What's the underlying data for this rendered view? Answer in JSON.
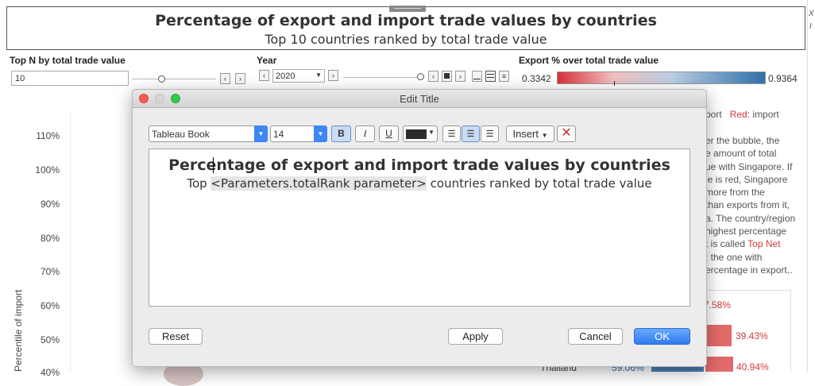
{
  "dashboard": {
    "title": "Percentage of export and import trade values by countries",
    "subtitle": "Top  10 countries ranked by total trade value"
  },
  "filters": {
    "topn_label": "Top N by total trade value",
    "topn_value": "10",
    "year_label": "Year",
    "year_value": "2020",
    "export_label": "Export % over total trade value",
    "export_min": "0.3342",
    "export_max": "0.9364",
    "gradient_colors": [
      "#d7323a",
      "#f2bfbf",
      "#b9cfe2",
      "#2e6fa8"
    ]
  },
  "chart": {
    "y_ticks": [
      "110%",
      "100%",
      "90%",
      "80%",
      "70%",
      "60%",
      "50%",
      "40%"
    ],
    "y_axis_label": "Percentile of import"
  },
  "legend": {
    "line1_tail": "port",
    "line1_red": "Red:",
    "line1_rest": " import",
    "lines": [
      "er the bubble, the",
      "e amount of total",
      "ue with Singapore. If",
      "le is red, Singapore",
      "more from the",
      "than exports from it,",
      "a. The country/region",
      "highest percentage",
      "t is called "
    ],
    "top_net_label": "Top Net",
    "semi": ";",
    "line_after": " the one with",
    "line_last": "ercentage in export.."
  },
  "bars": [
    {
      "value_label": "7.58%"
    },
    {
      "value_label": "39.43%"
    },
    {
      "country": "Thailand",
      "share": "59.06%",
      "value_label": "40.94%"
    }
  ],
  "dialog": {
    "window_title": "Edit Title",
    "font_name": "Tableau Book",
    "font_size": "14",
    "bold_label": "B",
    "italic_label": "I",
    "underline_label": "U",
    "insert_label": "Insert",
    "text_color": "#2b2b2b",
    "editor_line1": "Percentage of export and import trade values by countries",
    "editor_line2_prefix": "Top ",
    "editor_param": "<Parameters.totalRank parameter>",
    "editor_line2_suffix": " countries ranked by total trade value",
    "reset_label": "Reset",
    "apply_label": "Apply",
    "cancel_label": "Cancel",
    "ok_label": "OK"
  }
}
